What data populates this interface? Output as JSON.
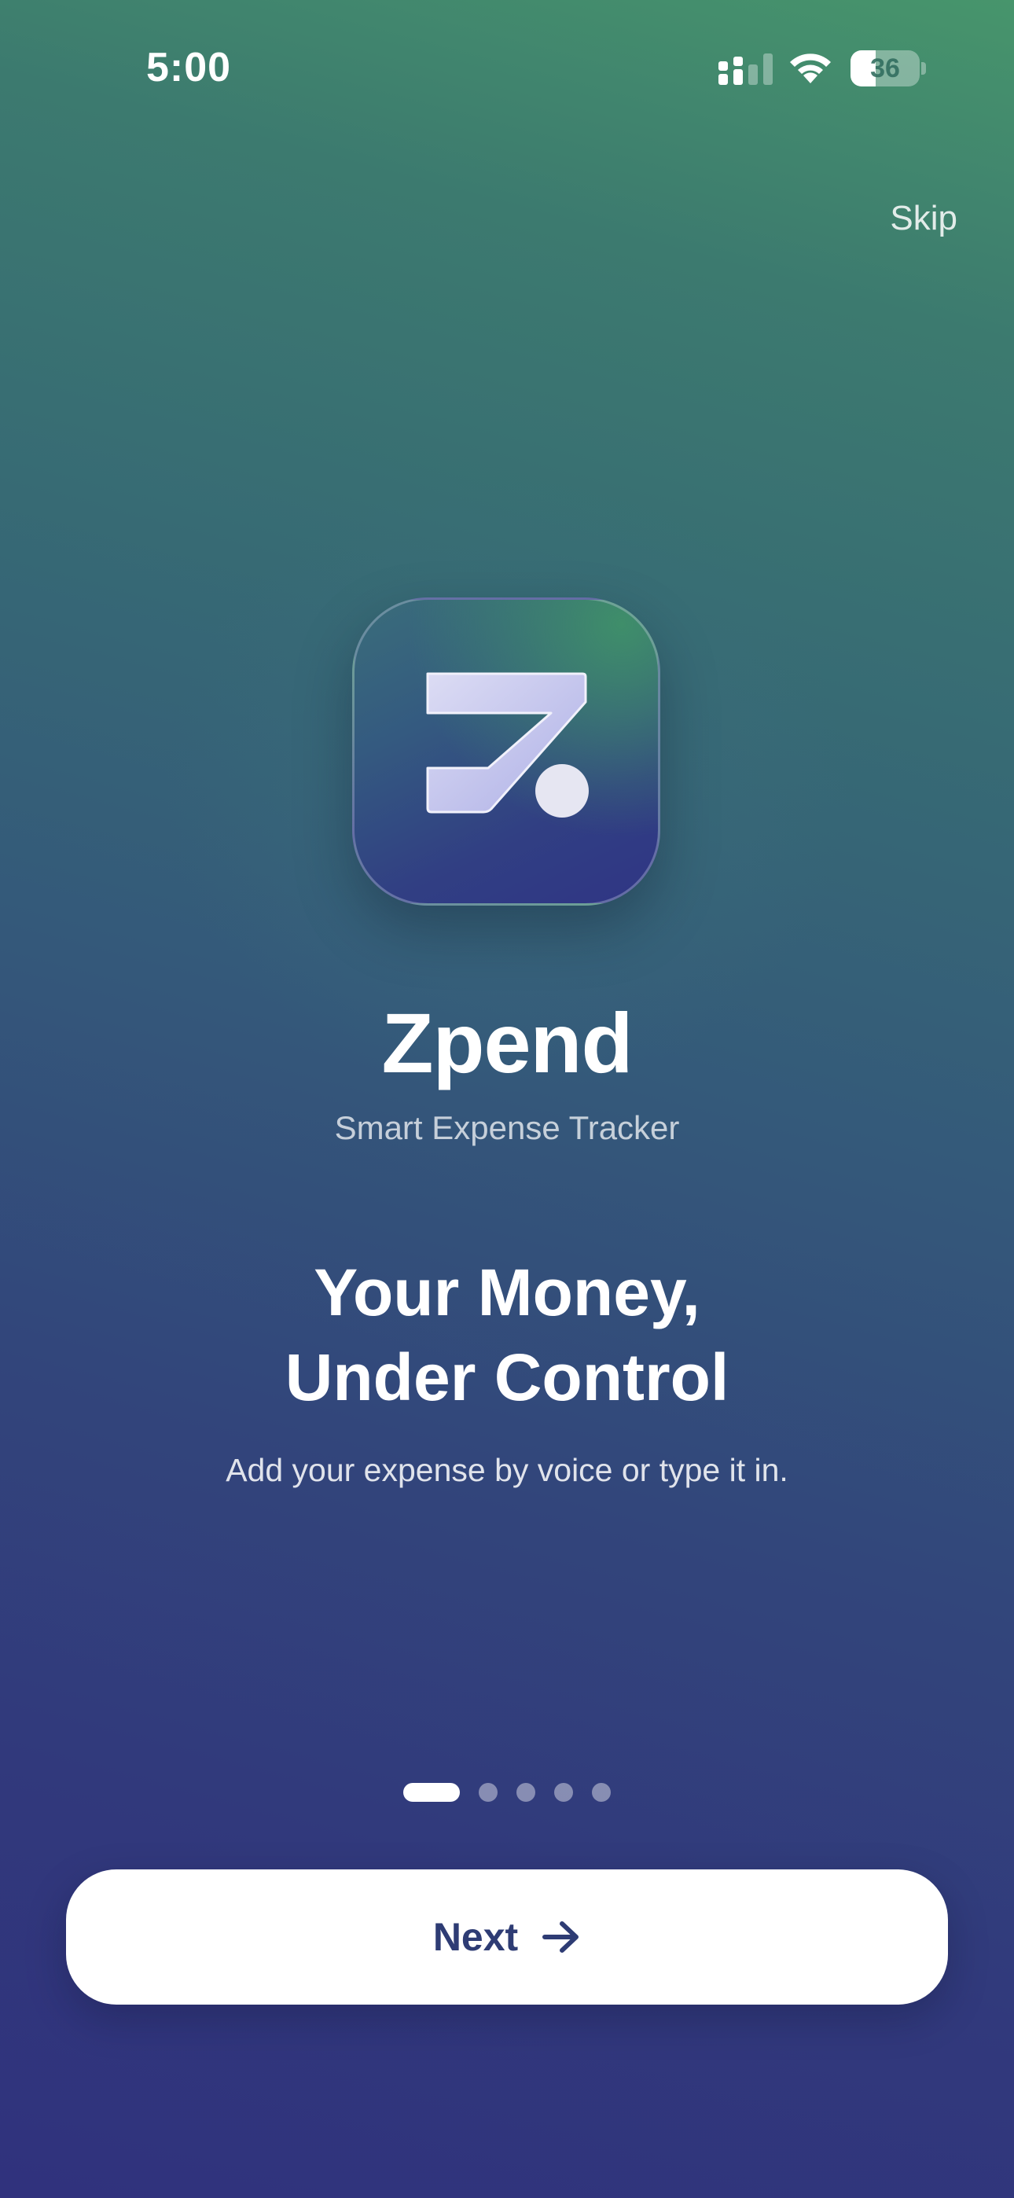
{
  "status_bar": {
    "time": "5:00",
    "battery_level": "36",
    "icons": [
      "cellular-signal-icon",
      "wifi-icon",
      "battery-icon"
    ]
  },
  "header": {
    "skip_label": "Skip"
  },
  "app": {
    "name": "Zpend",
    "tagline": "Smart Expense Tracker",
    "logo_icon": "zpend-logo-icon"
  },
  "onboarding": {
    "headline_line1": "Your Money,",
    "headline_line2": "Under Control",
    "description": "Add your expense by voice or type it in.",
    "total_pages": 5,
    "current_page": 1
  },
  "footer": {
    "next_label": "Next",
    "next_icon": "arrow-right-icon"
  },
  "colors": {
    "gradient_top": "#47956c",
    "gradient_bottom": "#30327d",
    "button_text": "#2e3c74",
    "button_bg": "#ffffff"
  }
}
